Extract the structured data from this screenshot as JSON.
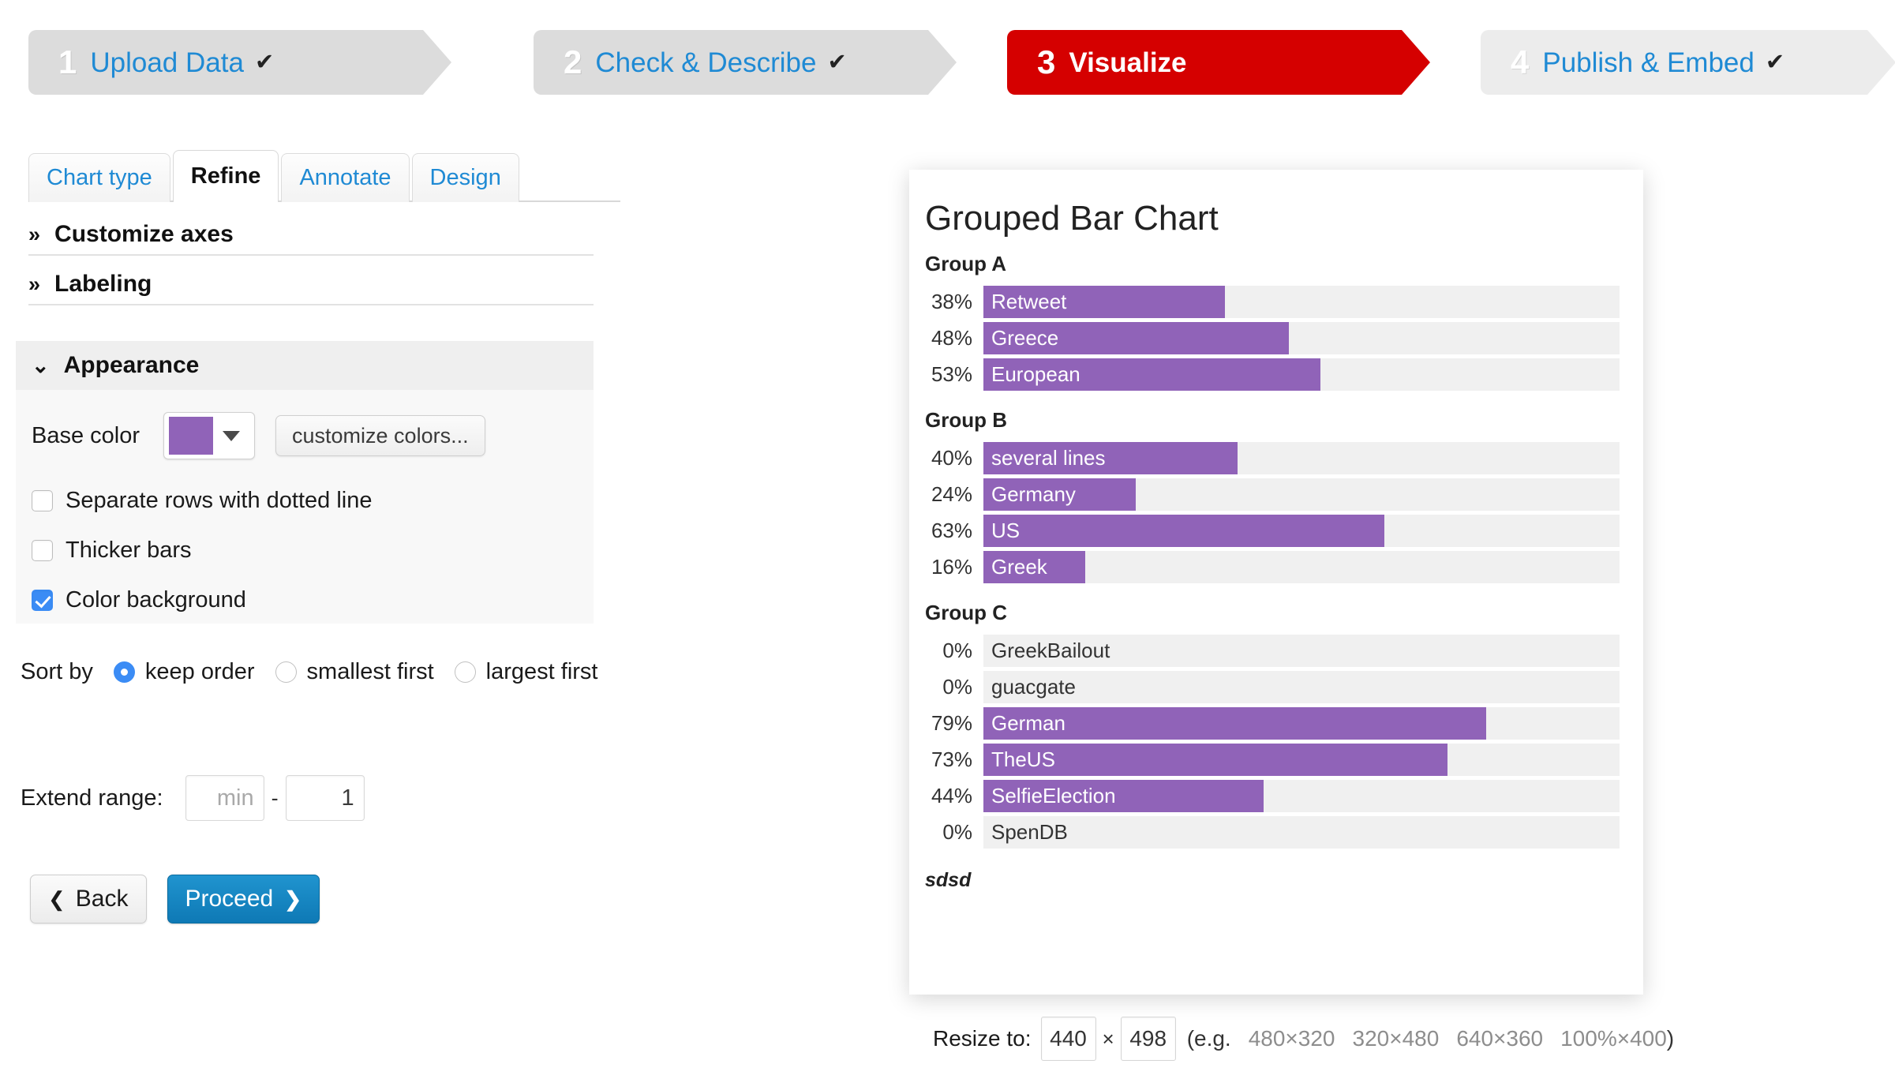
{
  "steps": [
    {
      "num": "1",
      "label": "Upload Data",
      "check": "✔",
      "state": "done"
    },
    {
      "num": "2",
      "label": "Check & Describe",
      "check": "✔",
      "state": "done"
    },
    {
      "num": "3",
      "label": "Visualize",
      "check": "",
      "state": "active"
    },
    {
      "num": "4",
      "label": "Publish & Embed",
      "check": "✔",
      "state": "done"
    }
  ],
  "tabs": [
    {
      "label": "Chart type",
      "active": false
    },
    {
      "label": "Refine",
      "active": true
    },
    {
      "label": "Annotate",
      "active": false
    },
    {
      "label": "Design",
      "active": false
    }
  ],
  "sections": {
    "axes": {
      "title": "Customize axes",
      "chevron": "»"
    },
    "labeling": {
      "title": "Labeling",
      "chevron": "»"
    },
    "appearance": {
      "title": "Appearance",
      "chevron": "⌄"
    }
  },
  "appearance": {
    "base_color_label": "Base color",
    "base_color_value": "#9063b8",
    "customize_colors_label": "customize colors...",
    "checkboxes": [
      {
        "label": "Separate rows with dotted line",
        "checked": false
      },
      {
        "label": "Thicker bars",
        "checked": false
      },
      {
        "label": "Color background",
        "checked": true
      }
    ],
    "checked_accent": "#3b8cf5"
  },
  "sort": {
    "label": "Sort by",
    "options": [
      {
        "label": "keep order",
        "selected": true
      },
      {
        "label": "smallest first",
        "selected": false
      },
      {
        "label": "largest first",
        "selected": false
      }
    ]
  },
  "extend_range": {
    "label": "Extend range:",
    "min_value": "",
    "min_placeholder": "min",
    "separator": "-",
    "max_value": "1",
    "max_placeholder": ""
  },
  "buttons": {
    "back_label": "Back",
    "back_icon": "❮",
    "proceed_label": "Proceed",
    "proceed_icon": "❯",
    "proceed_color": "#1380b8"
  },
  "resize": {
    "label": "Resize to:",
    "width_value": "440",
    "height_value": "498",
    "times": "×",
    "eg_label": "(e.g.",
    "presets": [
      "480×320",
      "320×480",
      "640×360",
      "100%×400"
    ],
    "close_paren": ")"
  },
  "chart_data": {
    "type": "bar",
    "orientation": "horizontal",
    "title": "Grouped Bar Chart",
    "note": "sdsd",
    "bar_color": "#9063b8",
    "track_color": "#f0f0f0",
    "value_suffix": "%",
    "xlim": [
      0,
      100
    ],
    "grid": false,
    "legend": "none",
    "groups": [
      {
        "name": "Group A",
        "rows": [
          {
            "label": "Retweet",
            "value": 38,
            "display": "38%"
          },
          {
            "label": "Greece",
            "value": 48,
            "display": "48%"
          },
          {
            "label": "European",
            "value": 53,
            "display": "53%"
          }
        ]
      },
      {
        "name": "Group B",
        "rows": [
          {
            "label": "several lines",
            "value": 40,
            "display": "40%"
          },
          {
            "label": "Germany",
            "value": 24,
            "display": "24%"
          },
          {
            "label": "US",
            "value": 63,
            "display": "63%"
          },
          {
            "label": "Greek",
            "value": 16,
            "display": "16%"
          }
        ]
      },
      {
        "name": "Group C",
        "rows": [
          {
            "label": "GreekBailout",
            "value": 0,
            "display": "0%"
          },
          {
            "label": "guacgate",
            "value": 0,
            "display": "0%"
          },
          {
            "label": "German",
            "value": 79,
            "display": "79%"
          },
          {
            "label": "TheUS",
            "value": 73,
            "display": "73%"
          },
          {
            "label": "SelfieElection",
            "value": 44,
            "display": "44%"
          },
          {
            "label": "SpenDB",
            "value": 0,
            "display": "0%"
          }
        ]
      }
    ]
  }
}
